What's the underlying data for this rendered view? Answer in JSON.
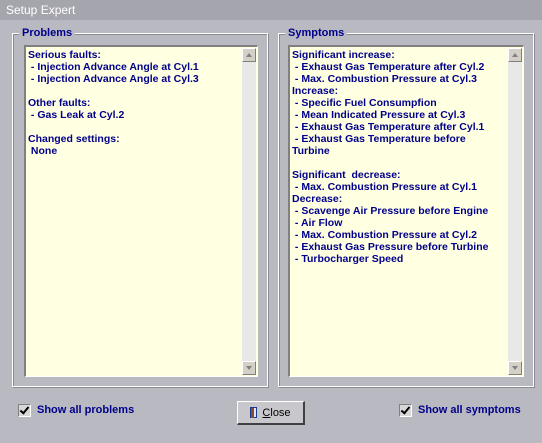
{
  "window": {
    "title": "Setup Expert"
  },
  "problems": {
    "label": "Problems",
    "lines": [
      "Serious faults:",
      " - Injection Advance Angle at Cyl.1",
      " - Injection Advance Angle at Cyl.3",
      "",
      "Other faults:",
      " - Gas Leak at Cyl.2",
      "",
      "Changed settings:",
      " None"
    ]
  },
  "symptoms": {
    "label": "Symptoms",
    "lines": [
      "Significant increase:",
      " - Exhaust Gas Temperature after Cyl.2",
      " - Max. Combustion Pressure at Cyl.3",
      "Increase:",
      " - Specific Fuel Consumpfion",
      " - Mean Indicated Pressure at Cyl.3",
      " - Exhaust Gas Temperature after Cyl.1",
      " - Exhaust Gas Temperature before",
      "Turbine",
      "",
      "Significant  decrease:",
      " - Max. Combustion Pressure at Cyl.1",
      "Decrease:",
      " - Scavenge Air Pressure before Engine",
      " - Air Flow",
      " - Max. Combustion Pressure at Cyl.2",
      " - Exhaust Gas Pressure before Turbine",
      " - Turbocharger Speed"
    ]
  },
  "controls": {
    "show_all_problems": {
      "label": "Show all problems",
      "checked": true
    },
    "show_all_symptoms": {
      "label": "Show all symptoms",
      "checked": true
    },
    "close_button": {
      "mnemonic": "C",
      "rest": "lose"
    }
  },
  "icons": {
    "close_button_icon": "door-icon",
    "scroll_up": "arrow-up-icon",
    "scroll_down": "arrow-down-icon"
  }
}
